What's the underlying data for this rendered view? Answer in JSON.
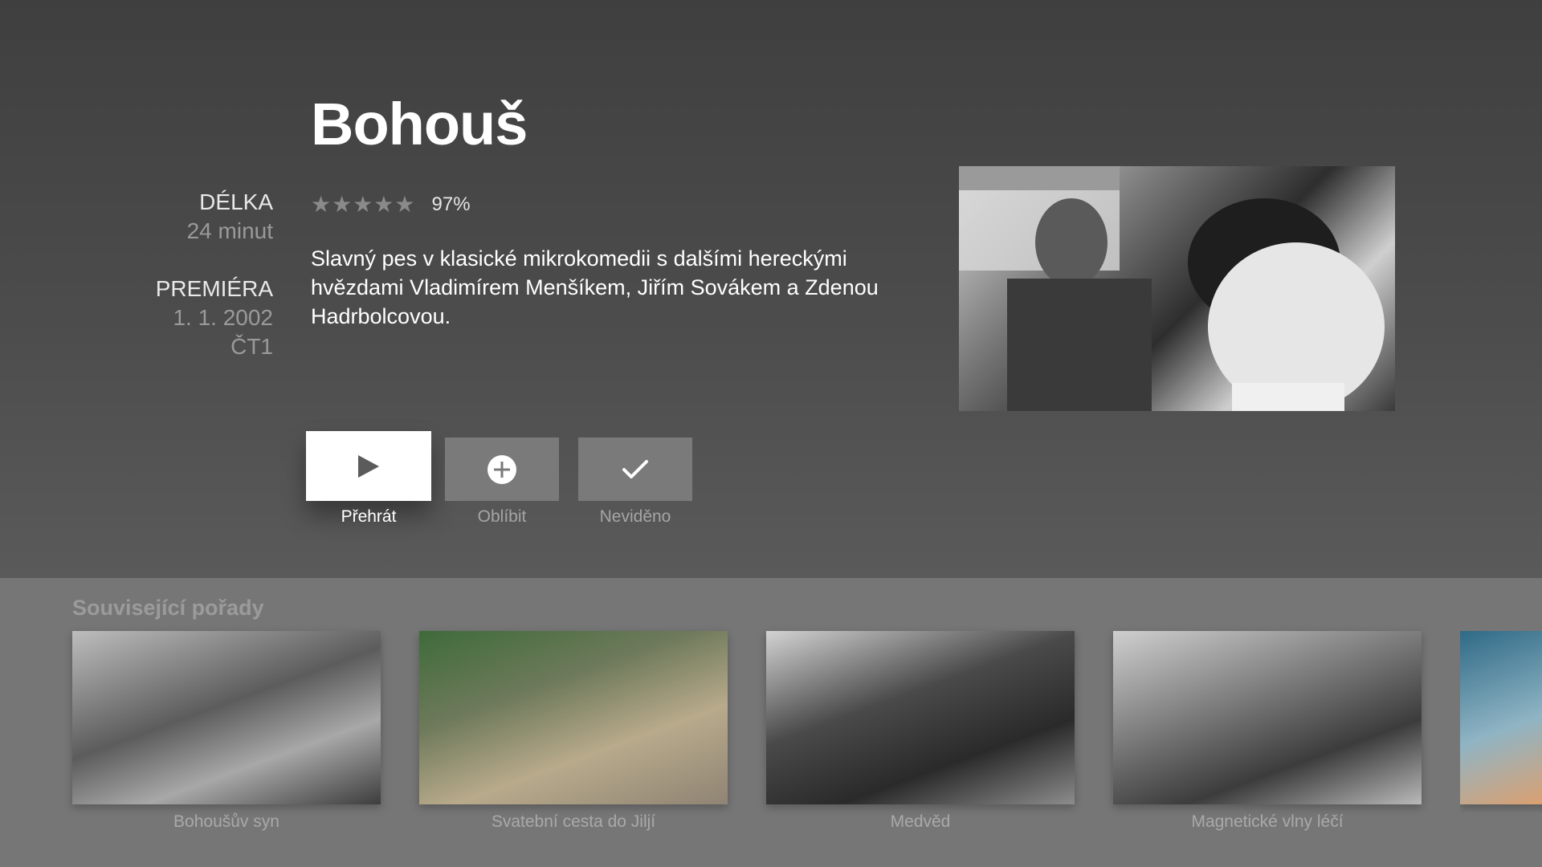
{
  "show": {
    "title": "Bohouš",
    "length_label": "DÉLKA",
    "length_value": "24 minut",
    "premiere_label": "PREMIÉRA",
    "premiere_date": "1. 1. 2002",
    "premiere_channel": "ČT1",
    "stars": "★★★★★",
    "rating_percent": "97%",
    "description": "Slavný pes v klasické mikrokomedii s dalšími hereckými hvězdami Vladimírem Menšíkem, Jiřím Sovákem a Zdenou Hadrbolcovou."
  },
  "actions": {
    "play_label": "Přehrát",
    "favorite_label": "Oblíbit",
    "unseen_label": "Neviděno"
  },
  "related": {
    "title": "Související pořady",
    "items": [
      {
        "label": "Bohoušův syn"
      },
      {
        "label": "Svatební cesta do Jiljí"
      },
      {
        "label": "Medvěd"
      },
      {
        "label": "Magnetické vlny léčí"
      },
      {
        "label": ""
      }
    ]
  },
  "colors": {
    "background": "#4a4a4a",
    "related_background": "#767676",
    "play_button": "#ffffff",
    "secondary_button": "#7a7a7a"
  },
  "icons": {
    "play": "play-icon",
    "favorite": "plus-circle-icon",
    "unseen": "checkmark-icon"
  }
}
